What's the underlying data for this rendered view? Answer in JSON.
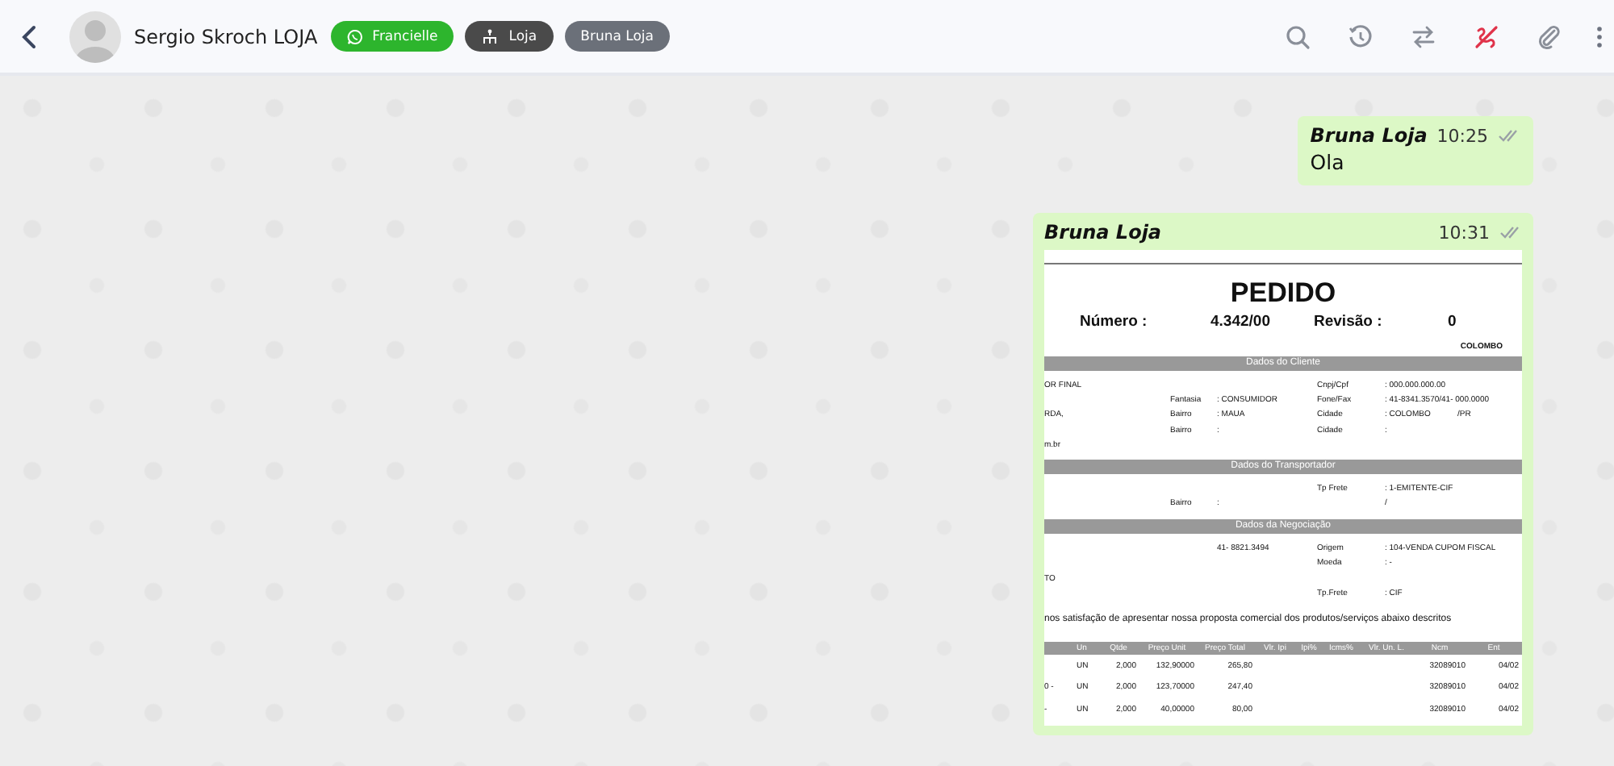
{
  "header": {
    "contact_name": "Sergio Skroch LOJA",
    "tags": [
      {
        "label": "Francielle",
        "kind": "whatsapp",
        "color": "#2db52d"
      },
      {
        "label": "Loja",
        "kind": "branch",
        "color": "#4a4a4a"
      },
      {
        "label": "Bruna Loja",
        "kind": "plain",
        "color": "#6b7079"
      }
    ]
  },
  "messages": [
    {
      "kind": "text",
      "sender": "Bruna Loja",
      "time": "10:25",
      "text": "Ola"
    },
    {
      "kind": "document",
      "sender": "Bruna Loja",
      "time": "10:31",
      "document": {
        "title": "PEDIDO",
        "number_label": "Número :",
        "number": "4.342/00",
        "revision_label": "Revisão :",
        "revision": "0",
        "city": "COLOMBO",
        "sections": [
          {
            "heading": "Dados do Cliente",
            "rows": [
              {
                "left": "OR FINAL",
                "right_label": "Cnpj/Cpf",
                "right_value": ":  000.000.000.00"
              },
              {
                "mid_label": "Fantasia",
                "mid_value": ":  CONSUMIDOR",
                "right_label": "Fone/Fax",
                "right_value": ":  41-8341.3570/41- 000.0000"
              },
              {
                "left": "RDA,",
                "mid_label": "Bairro",
                "mid_value": ":  MAUA",
                "right_label": "Cidade",
                "right_value": ":  COLOMBO",
                "extra": "/PR"
              },
              {
                "mid_label": "Bairro",
                "mid_value": ":",
                "right_label": "Cidade",
                "right_value": ":"
              },
              {
                "left": "m.br"
              }
            ]
          },
          {
            "heading": "Dados do Transportador",
            "rows": [
              {
                "right_label": "Tp Frete",
                "right_value": ":  1-EMITENTE-CIF"
              },
              {
                "mid_label": "Bairro",
                "mid_value": ":",
                "right_value": "   /"
              }
            ]
          },
          {
            "heading": "Dados da Negociação",
            "rows": [
              {
                "mid_value": "41- 8821.3494",
                "right_label": "Origem",
                "right_value": ":  104-VENDA CUPOM FISCAL"
              },
              {
                "right_label": "Moeda",
                "right_value": ":  -"
              },
              {
                "left": "TO"
              },
              {
                "right_label": "Tp.Frete",
                "right_value": ":  CIF"
              }
            ]
          }
        ],
        "intro": "nos satisfação de apresentar nossa proposta comercial dos produtos/serviços abaixo descritos",
        "table": {
          "columns": [
            "Un",
            "Qtde",
            "Preço Unit",
            "Preço Total",
            "Vlr. Ipi",
            "Ipi%",
            "Icms%",
            "Vlr. Un. L.",
            "Ncm",
            "Ent"
          ],
          "rows": [
            {
              "un": "UN",
              "qtde": "2,000",
              "preco_unit": "132,90000",
              "preco_total": "265,80",
              "ncm": "32089010",
              "column_10": "04/02"
            },
            {
              "lead": "0 -",
              "un": "UN",
              "qtde": "2,000",
              "preco_unit": "123,70000",
              "preco_total": "247,40",
              "ncm": "32089010",
              "column_10": "04/02"
            },
            {
              "lead": "-",
              "un": "UN",
              "qtde": "2,000",
              "preco_unit": "40,00000",
              "preco_total": "80,00",
              "ncm": "32089010",
              "column_10": "04/02"
            }
          ]
        }
      }
    }
  ]
}
